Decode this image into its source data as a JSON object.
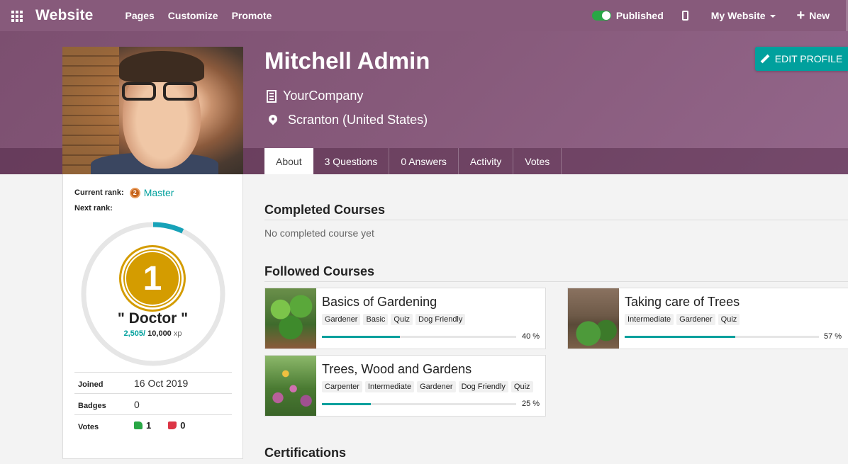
{
  "topbar": {
    "brand": "Website",
    "nav": [
      "Pages",
      "Customize",
      "Promote"
    ],
    "published_label": "Published",
    "my_website_label": "My Website",
    "new_label": "New"
  },
  "profile": {
    "name": "Mitchell Admin",
    "company": "YourCompany",
    "location": "Scranton (United States)",
    "edit_label": "EDIT PROFILE"
  },
  "tabs": [
    "About",
    "3 Questions",
    "0 Answers",
    "Activity",
    "Votes"
  ],
  "sidebar": {
    "current_rank_label": "Current rank:",
    "current_rank_badge": "2",
    "current_rank": "Master",
    "next_rank_label": "Next rank:",
    "medal_number": "1",
    "next_rank_name": "\" Doctor \"",
    "xp_current": "2,505/",
    "xp_max": "10,000",
    "xp_unit": "xp",
    "progress_fraction": 0.07,
    "joined_label": "Joined",
    "joined_value": "16 Oct 2019",
    "badges_label": "Badges",
    "badges_value": "0",
    "votes_label": "Votes",
    "votes_up": "1",
    "votes_down": "0"
  },
  "main": {
    "completed_title": "Completed Courses",
    "completed_empty": "No completed course yet",
    "followed_title": "Followed Courses",
    "certifications_title": "Certifications",
    "courses": [
      {
        "title": "Basics of Gardening",
        "tags": [
          "Gardener",
          "Basic",
          "Quiz",
          "Dog Friendly"
        ],
        "progress": 40,
        "progress_label": "40 %"
      },
      {
        "title": "Taking care of Trees",
        "tags": [
          "Intermediate",
          "Gardener",
          "Quiz"
        ],
        "progress": 57,
        "progress_label": "57 %"
      },
      {
        "title": "Trees, Wood and Gardens",
        "tags": [
          "Carpenter",
          "Intermediate",
          "Gardener",
          "Dog Friendly",
          "Quiz"
        ],
        "progress": 25,
        "progress_label": "25 %"
      }
    ]
  },
  "colors": {
    "brand_purple": "#875a7b",
    "accent_teal": "#00a09d",
    "medal_gold": "#d49c00"
  }
}
